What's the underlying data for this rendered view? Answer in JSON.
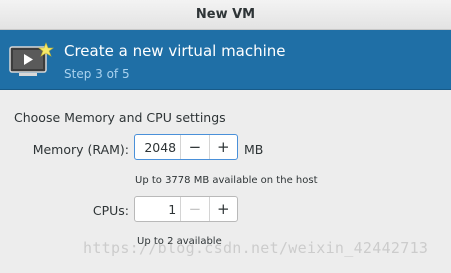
{
  "window": {
    "title": "New VM"
  },
  "header": {
    "title": "Create a new virtual machine",
    "step": "Step 3 of 5",
    "icon": "vm-monitor-icon",
    "bg_color": "#1f6fa6"
  },
  "section": {
    "title": "Choose Memory and CPU settings"
  },
  "memory": {
    "label": "Memory (RAM):",
    "value": "2048",
    "decrement": "−",
    "increment": "+",
    "unit": "MB",
    "hint": "Up to 3778 MB available on the host"
  },
  "cpus": {
    "label": "CPUs:",
    "value": "1",
    "decrement": "−",
    "increment": "+",
    "hint": "Up to 2 available"
  },
  "watermark": "https://blog.csdn.net/weixin_42442713"
}
